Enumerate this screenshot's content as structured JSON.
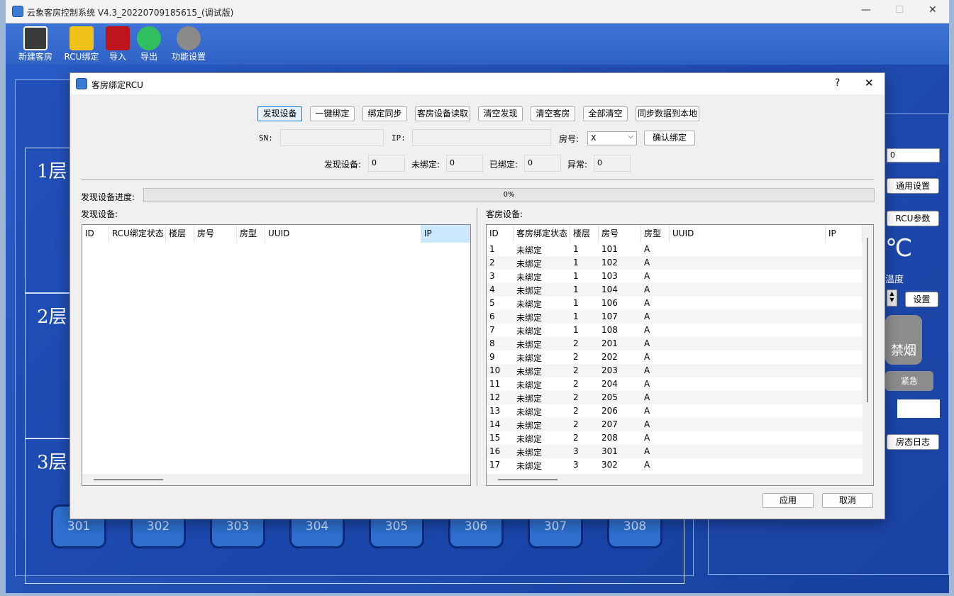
{
  "app": {
    "title": "云象客房控制系统 V4.3_20220709185615_(调试版)",
    "window_controls": [
      "—",
      "☐",
      "✕"
    ]
  },
  "toolbar": {
    "items": [
      {
        "label": "新建客房",
        "icon": "new-room-icon",
        "color": "#3a3a3a"
      },
      {
        "label": "RCU绑定",
        "icon": "rcu-bind-icon",
        "color": "#f2c21b"
      },
      {
        "label": "导入",
        "icon": "import-icon",
        "color": "#c0141c"
      },
      {
        "label": "导出",
        "icon": "export-icon",
        "color": "#2fbf60"
      },
      {
        "label": "功能设置",
        "icon": "gear-icon",
        "color": "#8a8a8a"
      }
    ]
  },
  "floors": [
    {
      "label": "1层"
    },
    {
      "label": "2层"
    },
    {
      "label": "3层",
      "rooms": [
        "301",
        "302",
        "303",
        "304",
        "305",
        "306",
        "307",
        "308"
      ]
    }
  ],
  "right_panel": {
    "value": "0",
    "general_settings": "通用设置",
    "rcu_params": "RCU参数",
    "celsius": "℃",
    "temperature": "温度",
    "set": "设置",
    "no_smoking": "禁烟",
    "emergency": "紧急",
    "room_log": "房态日志"
  },
  "dialog": {
    "title": "客房绑定RCU",
    "help": "?",
    "close": "✕",
    "buttons": [
      "发现设备",
      "一键绑定",
      "绑定同步",
      "客房设备读取",
      "清空发现",
      "清空客房",
      "全部清空",
      "同步数据到本地"
    ],
    "sn_label": "SN:",
    "ip_label": "IP:",
    "room_label": "房号:",
    "room_value": "X",
    "confirm_bind": "确认绑定",
    "stats": [
      {
        "label": "发现设备:",
        "value": "0"
      },
      {
        "label": "未绑定:",
        "value": "0"
      },
      {
        "label": "已绑定:",
        "value": "0"
      },
      {
        "label": "异常:",
        "value": "0"
      }
    ],
    "progress_label": "发现设备进度:",
    "progress_text": "0%",
    "progress": 0,
    "left_title": "发现设备:",
    "left_columns": [
      "ID",
      "RCU绑定状态",
      "楼层",
      "房号",
      "房型",
      "UUID",
      "IP"
    ],
    "right_title": "客房设备:",
    "right_columns": [
      "ID",
      "客房绑定状态",
      "楼层",
      "房号",
      "房型",
      "UUID",
      "IP"
    ],
    "rows": [
      [
        "1",
        "未绑定",
        "1",
        "101",
        "A"
      ],
      [
        "2",
        "未绑定",
        "1",
        "102",
        "A"
      ],
      [
        "3",
        "未绑定",
        "1",
        "103",
        "A"
      ],
      [
        "4",
        "未绑定",
        "1",
        "104",
        "A"
      ],
      [
        "5",
        "未绑定",
        "1",
        "106",
        "A"
      ],
      [
        "6",
        "未绑定",
        "1",
        "107",
        "A"
      ],
      [
        "7",
        "未绑定",
        "1",
        "108",
        "A"
      ],
      [
        "8",
        "未绑定",
        "2",
        "201",
        "A"
      ],
      [
        "9",
        "未绑定",
        "2",
        "202",
        "A"
      ],
      [
        "10",
        "未绑定",
        "2",
        "203",
        "A"
      ],
      [
        "11",
        "未绑定",
        "2",
        "204",
        "A"
      ],
      [
        "12",
        "未绑定",
        "2",
        "205",
        "A"
      ],
      [
        "13",
        "未绑定",
        "2",
        "206",
        "A"
      ],
      [
        "14",
        "未绑定",
        "2",
        "207",
        "A"
      ],
      [
        "15",
        "未绑定",
        "2",
        "208",
        "A"
      ],
      [
        "16",
        "未绑定",
        "3",
        "301",
        "A"
      ],
      [
        "17",
        "未绑定",
        "3",
        "302",
        "A"
      ]
    ],
    "apply": "应用",
    "cancel": "取消"
  }
}
